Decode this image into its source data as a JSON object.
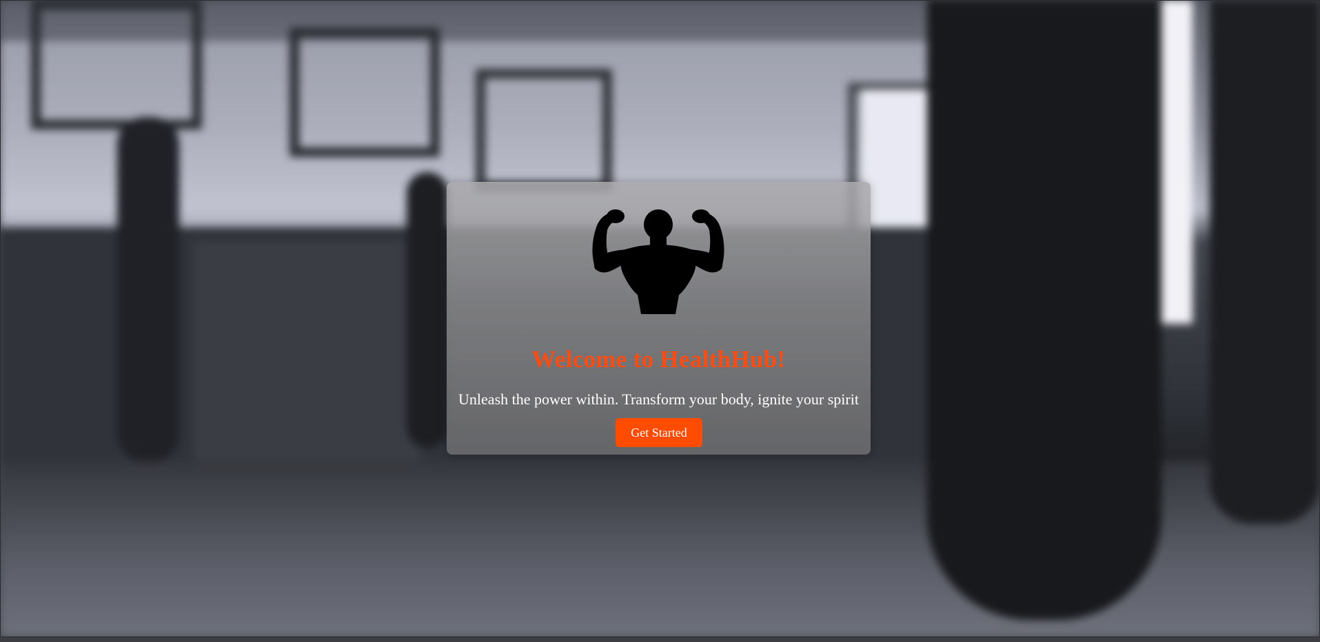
{
  "hero": {
    "title": "Welcome to HealthHub!",
    "tagline": "Unleash the power within. Transform your body, ignite your spirit",
    "cta_label": "Get Started",
    "logo_icon": "flexing-bodybuilder-icon"
  },
  "colors": {
    "accent": "#ff4c12",
    "button_bg": "#ff4c00",
    "text_light": "#ffffff"
  }
}
